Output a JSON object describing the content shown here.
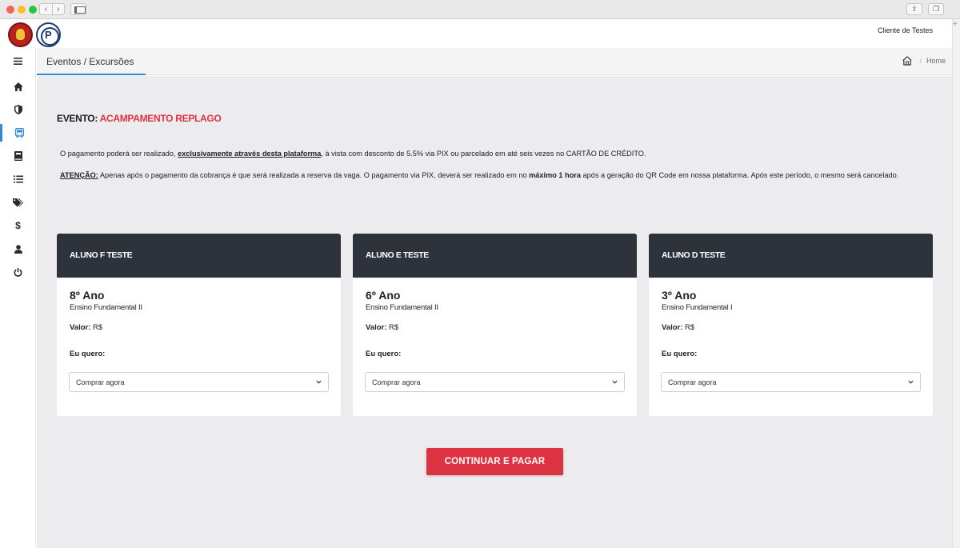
{
  "browser": {
    "nav_back_icon": "chevron-left-icon",
    "nav_forward_icon": "chevron-right-icon"
  },
  "topbar": {
    "user_name": "Cliente de Testes",
    "logo_primary_icon": "school-crest-logo",
    "logo_secondary_icon": "platform-p-logo"
  },
  "sidebar": {
    "items": [
      {
        "icon": "menu-icon",
        "active": false
      },
      {
        "icon": "home-icon",
        "active": false
      },
      {
        "icon": "shield-icon",
        "active": false
      },
      {
        "icon": "bus-icon",
        "active": true
      },
      {
        "icon": "book-icon",
        "active": false
      },
      {
        "icon": "list-icon",
        "active": false
      },
      {
        "icon": "tags-icon",
        "active": false
      },
      {
        "icon": "dollar-icon",
        "active": false
      },
      {
        "icon": "user-icon",
        "active": false
      },
      {
        "icon": "power-icon",
        "active": false
      }
    ],
    "accent_color": "#2e8bd1"
  },
  "header": {
    "title": "Eventos / Excursões",
    "breadcrumb_sep": "/",
    "breadcrumb_home": "Home"
  },
  "event": {
    "label": "EVENTO:",
    "name": "ACAMPAMENTO REPLAGO",
    "name_color": "#e0313f",
    "info1_pre": "O pagamento poderá ser realizado, ",
    "info1_bold": "exclusivamente através desta plataforma",
    "info1_post": ", à vista com desconto de 5.5% via PIX ou parcelado em até seis vezes no CARTÃO DE CRÉDITO.",
    "info2_label": "ATENÇÃO:",
    "info2_pre": " Apenas após o pagamento da cobrança é que será realizada a reserva da vaga. O pagamento via PIX, deverá ser realizado em no ",
    "info2_bold": "máximo 1 hora",
    "info2_post": " após a geração do QR Code em nossa plataforma. Após este período, o mesmo será cancelado."
  },
  "cards": [
    {
      "student": "ALUNO F TESTE",
      "grade": "8º Ano",
      "level": "Ensino Fundamental II",
      "price_label": "Valor:",
      "price_value": "R$",
      "want_label": "Eu quero:",
      "select_value": "Comprar agora"
    },
    {
      "student": "ALUNO E TESTE",
      "grade": "6º Ano",
      "level": "Ensino Fundamental II",
      "price_label": "Valor:",
      "price_value": "R$",
      "want_label": "Eu quero:",
      "select_value": "Comprar agora"
    },
    {
      "student": "ALUNO D TESTE",
      "grade": "3º Ano",
      "level": "Ensino Fundamental I",
      "price_label": "Valor:",
      "price_value": "R$",
      "want_label": "Eu quero:",
      "select_value": "Comprar agora"
    }
  ],
  "actions": {
    "pay_label": "CONTINUAR E PAGAR",
    "pay_color": "#dd3242"
  },
  "colors": {
    "card_header": "#2e333b",
    "content_bg": "#ececef"
  }
}
